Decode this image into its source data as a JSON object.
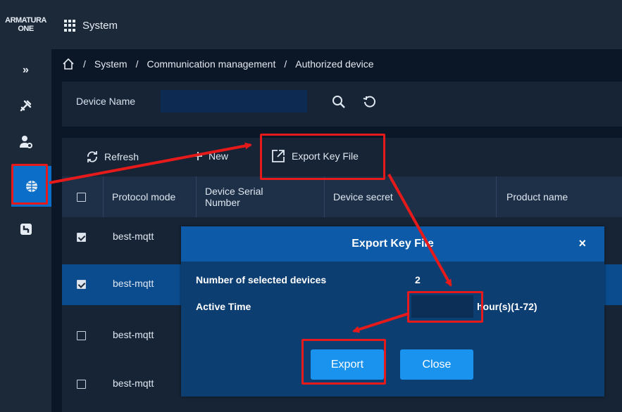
{
  "brand": {
    "line1": "ARMATURA",
    "line2": "ONE"
  },
  "app": {
    "title": "System"
  },
  "breadcrumb": {
    "items": [
      "System",
      "Communication management",
      "Authorized device"
    ],
    "separator": "/"
  },
  "search": {
    "device_name_label": "Device Name",
    "device_name_value": ""
  },
  "toolbar": {
    "refresh_label": "Refresh",
    "new_label": "New",
    "export_label": "Export Key File"
  },
  "table": {
    "headers": {
      "protocol_mode": "Protocol mode",
      "serial_line1": "Device Serial",
      "serial_line2": "Number",
      "secret": "Device secret",
      "product": "Product name"
    },
    "rows": [
      {
        "protocol": "best-mqtt",
        "checked": true
      },
      {
        "protocol": "best-mqtt",
        "checked": true
      },
      {
        "protocol": "best-mqtt",
        "checked": false
      },
      {
        "protocol": "best-mqtt",
        "checked": false
      }
    ]
  },
  "modal": {
    "title": "Export Key File",
    "close_glyph": "×",
    "selected_label": "Number of selected devices",
    "selected_value": "2",
    "active_time_label": "Active Time",
    "active_time_value": "",
    "hour_hint": "hour(s)(1-72)",
    "export_button": "Export",
    "close_button": "Close"
  },
  "colors": {
    "accent": "#1a93ef",
    "highlight": "#e61a1a",
    "modal_header": "#0d5aa8",
    "sidebar_active": "#0b6fc9"
  }
}
